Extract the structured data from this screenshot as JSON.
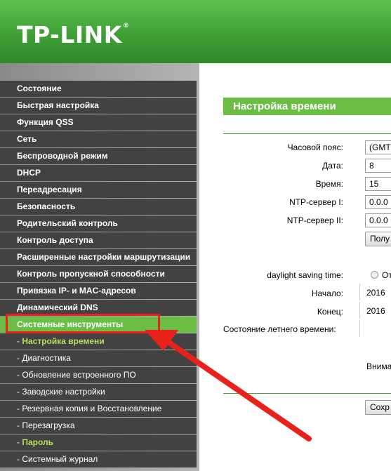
{
  "brand": {
    "logo_text": "TP-LINK",
    "reg_mark": "®"
  },
  "colors": {
    "header_green": "#3f9f35",
    "accent_green": "#6cbd45",
    "menu_dark": "#424242",
    "highlight_red": "#e8221b",
    "submenu_active": "#b8e05a"
  },
  "sidebar": {
    "items": [
      {
        "label": "Состояние"
      },
      {
        "label": "Быстрая настройка"
      },
      {
        "label": "Функция QSS"
      },
      {
        "label": "Сеть"
      },
      {
        "label": "Беспроводной режим"
      },
      {
        "label": "DHCP"
      },
      {
        "label": "Переадресация"
      },
      {
        "label": "Безопасность"
      },
      {
        "label": "Родительский контроль"
      },
      {
        "label": "Контроль доступа"
      },
      {
        "label": "Расширенные настройки маршрутизации"
      },
      {
        "label": "Контроль пропускной способности"
      },
      {
        "label": "Привязка IP- и MAC-адресов"
      },
      {
        "label": "Динамический DNS"
      },
      {
        "label": "Системные инструменты"
      },
      {
        "label": "- Настройка времени"
      },
      {
        "label": "- Диагностика"
      },
      {
        "label": "- Обновление встроенного ПО"
      },
      {
        "label": "- Заводские настройки"
      },
      {
        "label": "- Резервная копия и Восстановление"
      },
      {
        "label": "- Перезагрузка"
      },
      {
        "label": "- Пароль"
      },
      {
        "label": "- Системный журнал"
      }
    ]
  },
  "main": {
    "section_title": "Настройка времени",
    "fields": {
      "timezone_label": "Часовой пояс:",
      "timezone_value": "(GMT",
      "date_label": "Дата:",
      "date_value": "8",
      "time_label": "Время:",
      "time_value": "15",
      "ntp1_label": "NTP-сервер I:",
      "ntp1_value": "0.0.0",
      "ntp2_label": "NTP-сервер II:",
      "ntp2_value": "0.0.0",
      "get_button": "Полу",
      "dst_label": "daylight saving time:",
      "dst_radio_label": "От",
      "start_label": "Начало:",
      "start_year": "2016",
      "end_label": "Конец:",
      "end_year": "2016",
      "dst_status_label": "Состояние летнего времени:",
      "note_text": "Внима",
      "save_button": "Сохр"
    }
  }
}
